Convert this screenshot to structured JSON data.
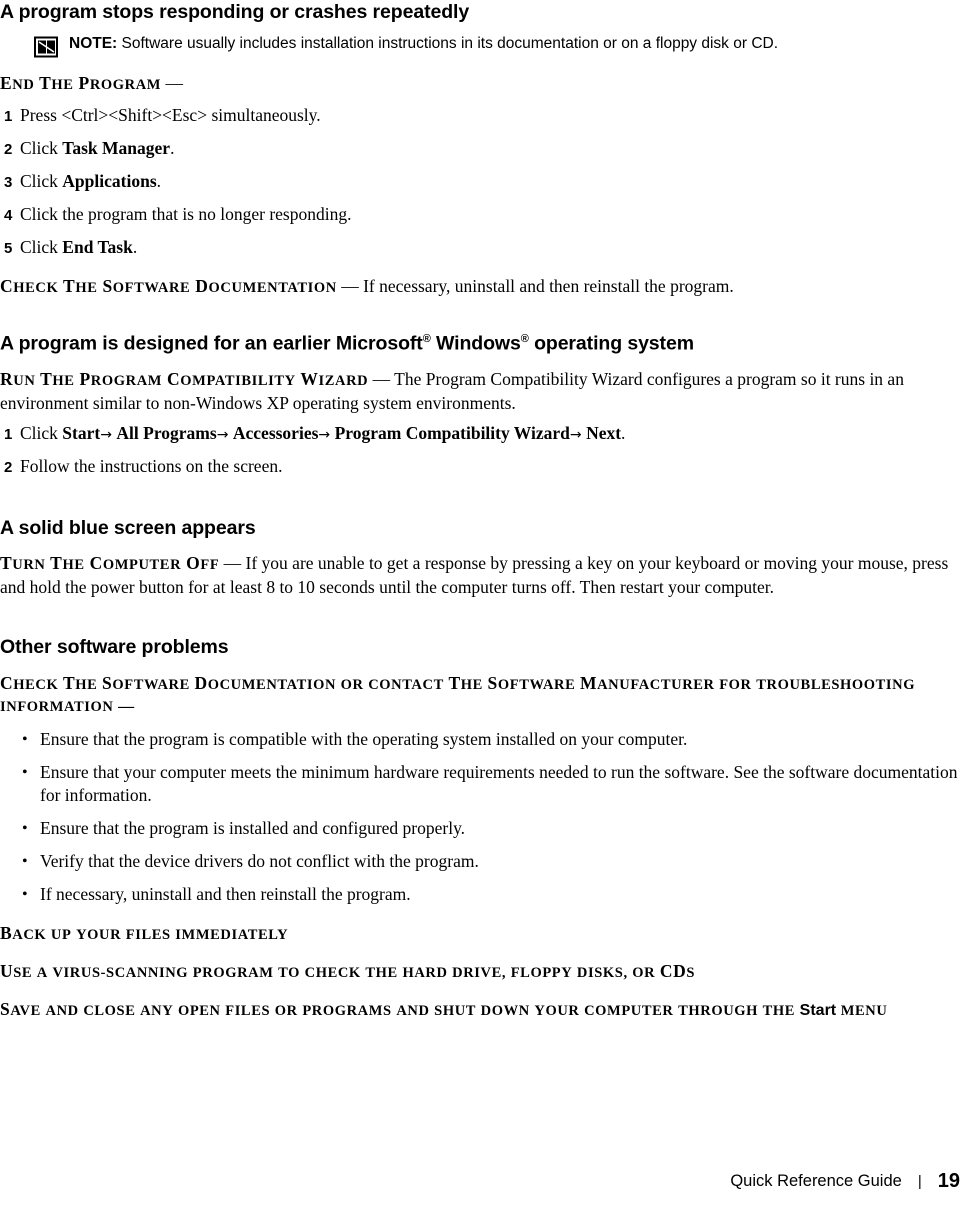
{
  "document": {
    "sections": [
      {
        "id": "program-stops-responding",
        "heading": "A program stops responding or crashes repeatedly",
        "note": {
          "label": "NOTE:",
          "text": " Software usually includes installation instructions in its documentation or on a floppy disk or CD."
        },
        "lead1": "END THE PROGRAM",
        "lead1_dash": " —",
        "steps": [
          {
            "num": "1",
            "text": "Press <Ctrl><Shift><Esc> simultaneously."
          },
          {
            "num": "2",
            "text": "Click ",
            "bold": "Task Manager",
            "tail": "."
          },
          {
            "num": "3",
            "text": "Click ",
            "bold": "Applications",
            "tail": "."
          },
          {
            "num": "4",
            "text": "Click the program that is no longer responding."
          },
          {
            "num": "5",
            "text": "Click ",
            "bold": "End Task",
            "tail": "."
          }
        ],
        "lead2": "CHECK THE SOFTWARE DOCUMENTATION",
        "lead2_body": " — If necessary, uninstall and then reinstall the program."
      },
      {
        "id": "earlier-windows",
        "heading_pre": "A program is designed for an earlier Microsoft",
        "heading_mid": " Windows",
        "heading_post": " operating system",
        "sup": "®",
        "lead": "RUN THE PROGRAM COMPATIBILITY WIZARD",
        "lead_body": " — The Program Compatibility Wizard configures a program so it runs in an environment similar to non-Windows XP operating system environments.",
        "steps": [
          {
            "num": "1",
            "text_parts": [
              "Click ",
              "Start",
              "→ ",
              "All Programs",
              "→ ",
              "Accessories",
              "→ ",
              "Program Compatibility Wizard",
              "→ ",
              "Next",
              "."
            ]
          },
          {
            "num": "2",
            "text": "Follow the instructions on the screen."
          }
        ]
      },
      {
        "id": "blue-screen",
        "heading": "A solid blue screen appears",
        "lead": "TURN THE COMPUTER OFF",
        "lead_body": " — If you are unable to get a response by pressing a key on your keyboard or moving your mouse, press and hold the power button for at least 8 to 10 seconds until the computer turns off. Then restart your computer."
      },
      {
        "id": "other-software",
        "heading": "Other software problems",
        "lead": "CHECK THE SOFTWARE DOCUMENTATION OR CONTACT THE SOFTWARE MANUFACTURER FOR TROUBLESHOOTING INFORMATION",
        "lead_dash": " —",
        "bullets": [
          "Ensure that the program is compatible with the operating system installed on your computer.",
          "Ensure that your computer meets the minimum hardware requirements needed to run the software. See the software documentation for information.",
          "Ensure that the program is installed and configured properly.",
          "Verify that the device drivers do not conflict with the program.",
          "If necessary, uninstall and then reinstall the program."
        ],
        "trailing": [
          {
            "text": "BACK UP YOUR FILES IMMEDIATELY"
          },
          {
            "text": "USE A VIRUS-SCANNING PROGRAM TO CHECK THE HARD DRIVE, FLOPPY DISKS, OR CDS"
          },
          {
            "text_pre": "SAVE AND CLOSE ANY OPEN FILES OR PROGRAMS AND SHUT DOWN YOUR COMPUTER THROUGH THE ",
            "bold_sans": "Start",
            "text_post": " MENU"
          }
        ]
      }
    ]
  },
  "footer": {
    "title": "Quick Reference Guide",
    "separator": "|",
    "page_number": "19"
  }
}
